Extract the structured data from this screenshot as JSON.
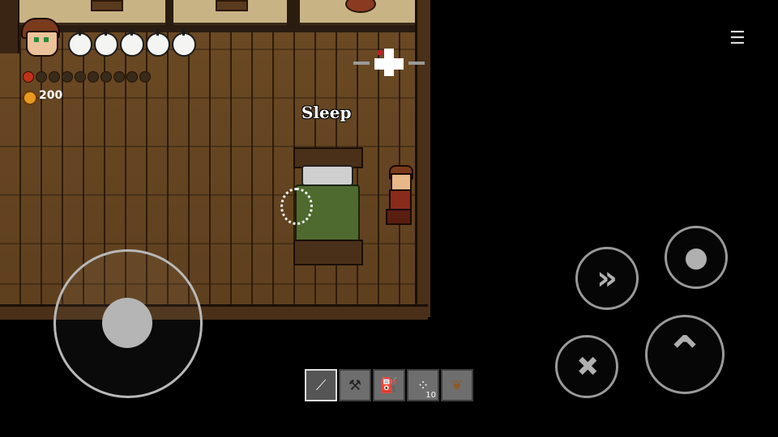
{
  "hud": {
    "health": {
      "max": 5,
      "filled": 5,
      "icon": "apple-icon"
    },
    "hunger": {
      "max": 10,
      "filled": 1,
      "icon": "food-icon"
    },
    "coins": "200"
  },
  "prompt": {
    "label": "Sleep"
  },
  "menu": {
    "icon": "menu-icon",
    "glyph": "☰"
  },
  "controls": {
    "joystick": {
      "icon": "joystick-icon"
    },
    "dash": {
      "icon": "dash-icon",
      "glyph": "»"
    },
    "eat": {
      "icon": "apple-icon",
      "glyph": "●"
    },
    "attack": {
      "icon": "sword-icon",
      "glyph": "✚"
    },
    "jump": {
      "icon": "jump-icon",
      "glyph": "⌃"
    }
  },
  "hotbar": {
    "selected": 0,
    "slots": [
      {
        "item": "sword-icon",
        "glyph": "⟋",
        "count": ""
      },
      {
        "item": "axe-icon",
        "glyph": "⚒",
        "count": ""
      },
      {
        "item": "watering-can-icon",
        "glyph": "⛽",
        "count": ""
      },
      {
        "item": "seeds-icon",
        "glyph": "⁘",
        "count": "10"
      },
      {
        "item": "feather-icon",
        "glyph": "❦",
        "count": ""
      }
    ]
  },
  "colors": {
    "floor": "#6b4a24",
    "hud_text": "#ffffff",
    "coin": "#e89a20",
    "control": "#9a9a9a"
  }
}
